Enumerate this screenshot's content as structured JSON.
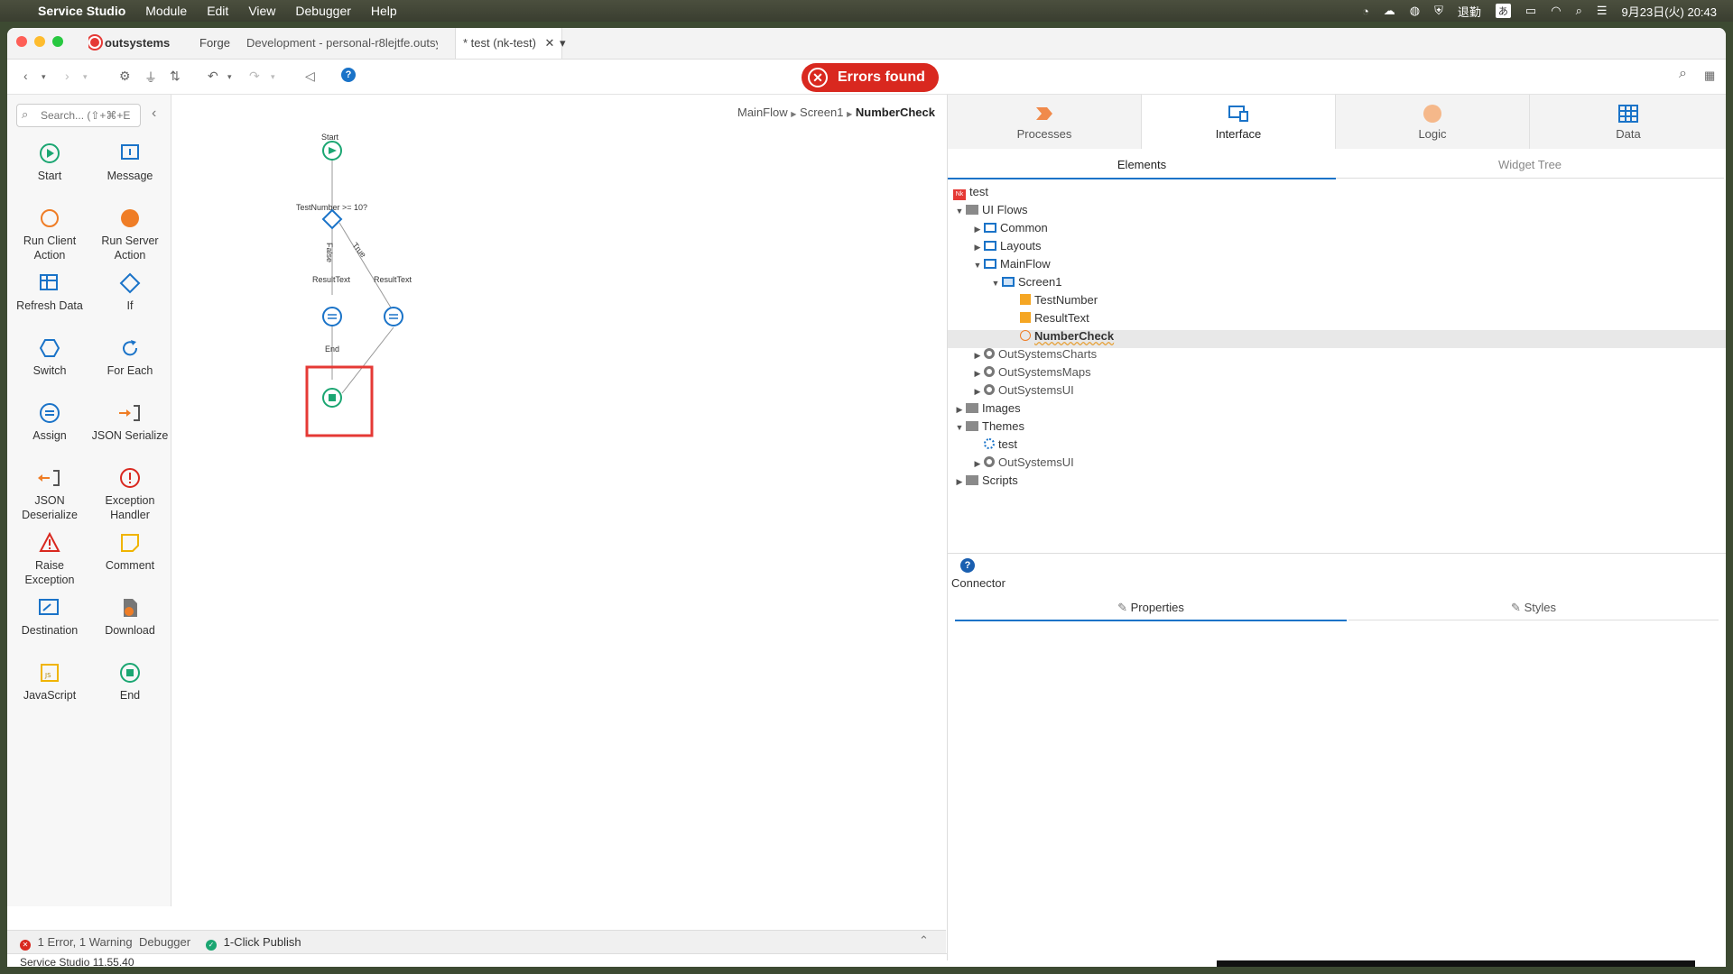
{
  "menubar": {
    "app": "Service Studio",
    "items": [
      "Module",
      "Edit",
      "View",
      "Debugger",
      "Help"
    ],
    "input_mode": "退勤",
    "kana": "あ",
    "datetime": "9月23日(火) 20:43"
  },
  "tabs": {
    "brand": "outsystems",
    "forge": "Forge",
    "dev": "Development - personal-r8lejtfe.outsys",
    "active": "* test (nk-test)",
    "close": "✕",
    "more": "▾"
  },
  "toolbar": {
    "errors": "Errors found",
    "help": "?"
  },
  "toolbox": {
    "search_placeholder": "Search... (⇧+⌘+E",
    "tools": [
      {
        "label": "Start"
      },
      {
        "label": "Message"
      },
      {
        "label": "Run Client Action"
      },
      {
        "label": "Run Server Action"
      },
      {
        "label": "Refresh Data"
      },
      {
        "label": "If"
      },
      {
        "label": "Switch"
      },
      {
        "label": "For Each"
      },
      {
        "label": "Assign"
      },
      {
        "label": "JSON Serialize"
      },
      {
        "label": "JSON Deserialize"
      },
      {
        "label": "Exception Handler"
      },
      {
        "label": "Raise Exception"
      },
      {
        "label": "Comment"
      },
      {
        "label": "Destination"
      },
      {
        "label": "Download"
      },
      {
        "label": "JavaScript"
      },
      {
        "label": "End"
      }
    ]
  },
  "canvas": {
    "breadcrumb": [
      "MainFlow",
      "Screen1",
      "NumberCheck"
    ],
    "nodes": {
      "start": "Start",
      "if": "TestNumber >= 10?",
      "assign_false": "ResultText",
      "assign_true": "ResultText",
      "end": "End",
      "false_label": "False",
      "true_label": "True"
    }
  },
  "bottombar": {
    "errors": "1 Error, 1 Warning",
    "debugger": "Debugger",
    "publish": "1-Click Publish"
  },
  "status": {
    "version": "Service Studio 11.55.40"
  },
  "rightpanel": {
    "tabs": [
      "Processes",
      "Interface",
      "Logic",
      "Data"
    ],
    "subtabs": [
      "Elements",
      "Widget Tree"
    ],
    "tree": [
      {
        "label": "test",
        "level": 0,
        "arrow": ""
      },
      {
        "label": "UI Flows",
        "level": 0,
        "arrow": "▼"
      },
      {
        "label": "Common",
        "level": 1,
        "arrow": "▶"
      },
      {
        "label": "Layouts",
        "level": 1,
        "arrow": "▶"
      },
      {
        "label": "MainFlow",
        "level": 1,
        "arrow": "▼"
      },
      {
        "label": "Screen1",
        "level": 2,
        "arrow": "▼"
      },
      {
        "label": "TestNumber",
        "level": 3,
        "arrow": ""
      },
      {
        "label": "ResultText",
        "level": 3,
        "arrow": ""
      },
      {
        "label": "NumberCheck",
        "level": 3,
        "arrow": ""
      },
      {
        "label": "OutSystemsCharts",
        "level": 1,
        "arrow": "▶"
      },
      {
        "label": "OutSystemsMaps",
        "level": 1,
        "arrow": "▶"
      },
      {
        "label": "OutSystemsUI",
        "level": 1,
        "arrow": "▶"
      },
      {
        "label": "Images",
        "level": 0,
        "arrow": "▶"
      },
      {
        "label": "Themes",
        "level": 0,
        "arrow": "▼"
      },
      {
        "label": "test",
        "level": 1,
        "arrow": ""
      },
      {
        "label": "OutSystemsUI",
        "level": 1,
        "arrow": "▶"
      },
      {
        "label": "Scripts",
        "level": 0,
        "arrow": "▶"
      }
    ],
    "connector": "Connector",
    "props_tabs": [
      "Properties",
      "Styles"
    ]
  },
  "colors": {
    "accent": "#1a73c8",
    "error": "#d9281f",
    "flow_node": "#1ba672",
    "highlight": "#e53935"
  }
}
